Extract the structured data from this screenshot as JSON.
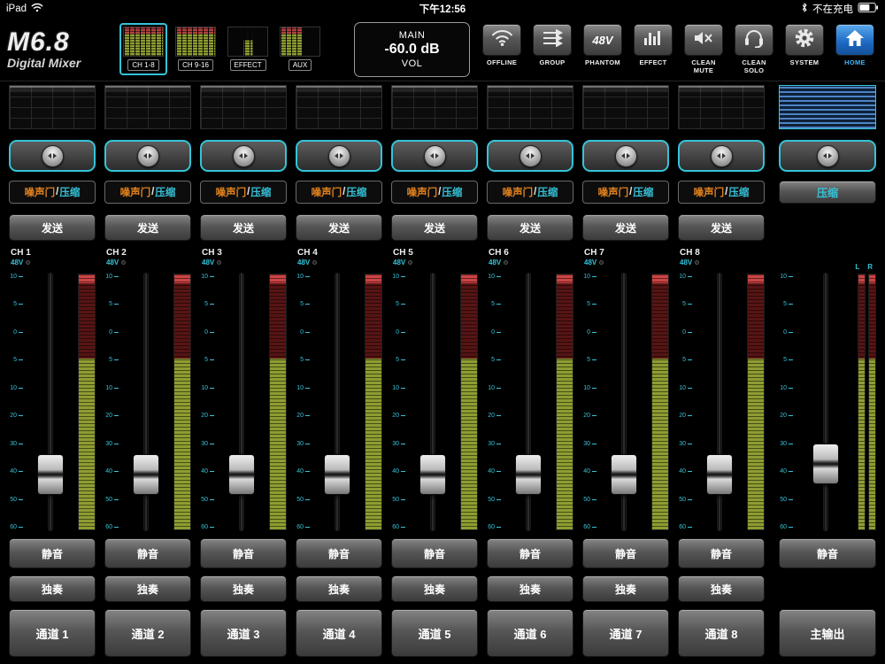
{
  "status_bar": {
    "device": "iPad",
    "time": "下午12:56",
    "battery_text": "不在充电"
  },
  "header": {
    "logo_title": "M6.8",
    "logo_subtitle": "Digital Mixer",
    "meter_tabs": [
      {
        "label": "CH 1-8",
        "active": true,
        "meter": "high"
      },
      {
        "label": "CH 9-16",
        "active": false,
        "meter": "high"
      },
      {
        "label": "EFFECT",
        "active": false,
        "meter": "low"
      },
      {
        "label": "AUX",
        "active": false,
        "meter": "med"
      }
    ],
    "main_display": {
      "bus": "MAIN",
      "level": "-60.0 dB",
      "mode": "VOL"
    },
    "buttons": [
      {
        "name": "offline-button",
        "label": "OFFLINE",
        "icon": "wifi-offline-icon",
        "active": false
      },
      {
        "name": "group-button",
        "label": "GROUP",
        "icon": "group-icon",
        "active": false
      },
      {
        "name": "phantom-button",
        "label": "PHANTOM",
        "icon": "phantom-48v-icon",
        "icon_text": "48V",
        "active": false
      },
      {
        "name": "effect-button",
        "label": "EFFECT",
        "icon": "effect-icon",
        "active": false
      },
      {
        "name": "clean-mute-button",
        "label": "CLEAN MUTE",
        "icon": "clean-mute-icon",
        "active": false
      },
      {
        "name": "clean-solo-button",
        "label": "CLEAN SOLO",
        "icon": "clean-solo-icon",
        "active": false
      },
      {
        "name": "system-button",
        "label": "SYSTEM",
        "icon": "system-icon",
        "active": false
      },
      {
        "name": "home-button",
        "label": "HOME",
        "icon": "home-icon",
        "active": true
      }
    ]
  },
  "labels": {
    "gate": "噪声门",
    "separator": "/",
    "comp": "压缩",
    "send": "发送",
    "mute": "静音",
    "solo": "独奏"
  },
  "fader_scale": [
    "10",
    "5",
    "0",
    "5",
    "10",
    "20",
    "30",
    "40",
    "50",
    "60"
  ],
  "channels": [
    {
      "name": "CH 1",
      "phantom": "48V",
      "select": "通道 1"
    },
    {
      "name": "CH 2",
      "phantom": "48V",
      "select": "通道 2"
    },
    {
      "name": "CH 3",
      "phantom": "48V",
      "select": "通道 3"
    },
    {
      "name": "CH 4",
      "phantom": "48V",
      "select": "通道 4"
    },
    {
      "name": "CH 5",
      "phantom": "48V",
      "select": "通道 5"
    },
    {
      "name": "CH 6",
      "phantom": "48V",
      "select": "通道 6"
    },
    {
      "name": "CH 7",
      "phantom": "48V",
      "select": "通道 7"
    },
    {
      "name": "CH 8",
      "phantom": "48V",
      "select": "通道 8"
    }
  ],
  "master": {
    "meter_left": "L",
    "meter_right": "R",
    "comp": "压缩",
    "mute": "静音",
    "select": "主输出"
  },
  "colors": {
    "accent_cyan": "#35c3d8",
    "accent_orange": "#e0821e",
    "home_blue": "#1c68c2",
    "meter_green": "#8f9c31",
    "meter_red": "#b24040"
  }
}
